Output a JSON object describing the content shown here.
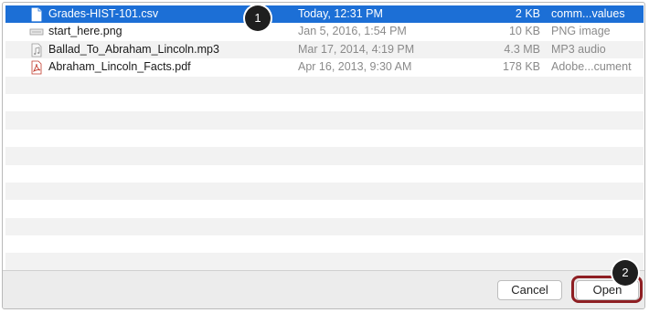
{
  "files": [
    {
      "name": "Grades-HIST-101.csv",
      "date": "Today, 12:31 PM",
      "size": "2 KB",
      "kind": "comm...values",
      "icon": "document-icon",
      "selected": true
    },
    {
      "name": "start_here.png",
      "date": "Jan 5, 2016, 1:54 PM",
      "size": "10 KB",
      "kind": "PNG image",
      "icon": "image-file-icon",
      "selected": false
    },
    {
      "name": "Ballad_To_Abraham_Lincoln.mp3",
      "date": "Mar 17, 2014, 4:19 PM",
      "size": "4.3 MB",
      "kind": "MP3 audio",
      "icon": "audio-file-icon",
      "selected": false
    },
    {
      "name": "Abraham_Lincoln_Facts.pdf",
      "date": "Apr 16, 2013, 9:30 AM",
      "size": "178 KB",
      "kind": "Adobe...cument",
      "icon": "pdf-file-icon",
      "selected": false
    }
  ],
  "buttons": {
    "cancel_label": "Cancel",
    "open_label": "Open"
  },
  "callouts": {
    "one": "1",
    "two": "2"
  },
  "colors": {
    "selection": "#1c6fd6",
    "highlight_ring": "#8e1f23",
    "callout": "#1f1f1f"
  }
}
